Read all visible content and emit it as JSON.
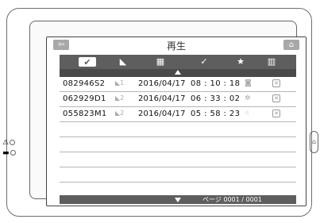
{
  "title": "再生",
  "toolbar": {
    "back_icon": "back-arrow-icon",
    "home_icon": "home-icon",
    "tabs": [
      {
        "icon": "checkmark-folder-icon",
        "glyph": "✔",
        "selected": true
      },
      {
        "icon": "camera-icon",
        "glyph": "◣"
      },
      {
        "icon": "calendar-icon",
        "glyph": "▦"
      },
      {
        "icon": "check-circle-icon",
        "glyph": "✓"
      },
      {
        "icon": "star-icon",
        "glyph": "★"
      },
      {
        "icon": "trash-icon",
        "glyph": "▥"
      }
    ]
  },
  "records": [
    {
      "id": "082946S2",
      "cam": "1",
      "date": "2016/04/17",
      "time": "08 : 10 : 18",
      "type_icon": "camera-icon",
      "delete_icon": "x-box-icon"
    },
    {
      "id": "062929D1",
      "cam": "2",
      "date": "2016/04/17",
      "time": "06 : 33 : 02",
      "type_icon": "motion-icon",
      "delete_icon": "x-box-icon"
    },
    {
      "id": "055823M1",
      "cam": "2",
      "date": "2016/04/17",
      "time": "05 : 58 : 23",
      "type_icon": "hand-icon",
      "delete_icon": "x-box-icon"
    }
  ],
  "empty_rows": 4,
  "footer": {
    "page_label": "ページ 0001 / 0001"
  },
  "side": {
    "left_top": "⚠",
    "left_bottom": "▬"
  },
  "colors": {
    "bar": "#5e5e5e",
    "button": "#a8a8a8"
  }
}
